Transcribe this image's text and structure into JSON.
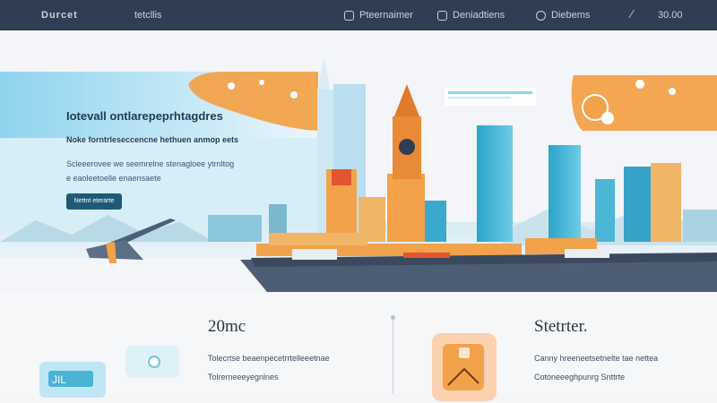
{
  "topbar": {
    "logo": "Durcet",
    "nav_link": "tetcllis",
    "items": [
      {
        "icon": "grid-icon",
        "label": "Pteernaimer"
      },
      {
        "icon": "camera-icon",
        "label": "Deniadtiens"
      },
      {
        "icon": "gear-icon",
        "label": "Diebems"
      }
    ],
    "price": "30.00"
  },
  "hero": {
    "title": "Iotevall ontlarepeprhtagdres",
    "subtitle": "Noke forntrleseccencne  hethuen anmop eets",
    "body": [
      "Scleeerovee we seemrelne stenagloee ytrnltog",
      "e eaoleetoelle enaensaete"
    ],
    "cta": "Nettnt eterarte"
  },
  "features": [
    {
      "stat": "20mc",
      "lines": [
        "Tolecrtse beaenpecetrrtelleeetnae",
        "Tolrerneeeyegnlnes"
      ]
    },
    {
      "stat": "Stetrter.",
      "lines": [
        "Canny hreeneetsetnelte tae nettea",
        "Cotoneeeghpunrg Snttrte"
      ]
    }
  ],
  "colors": {
    "topbar": "#2f3e53",
    "accent_orange": "#f2a24a",
    "accent_blue": "#2aa5c9",
    "cta": "#1e5a78",
    "heading": "#1f3a57"
  }
}
